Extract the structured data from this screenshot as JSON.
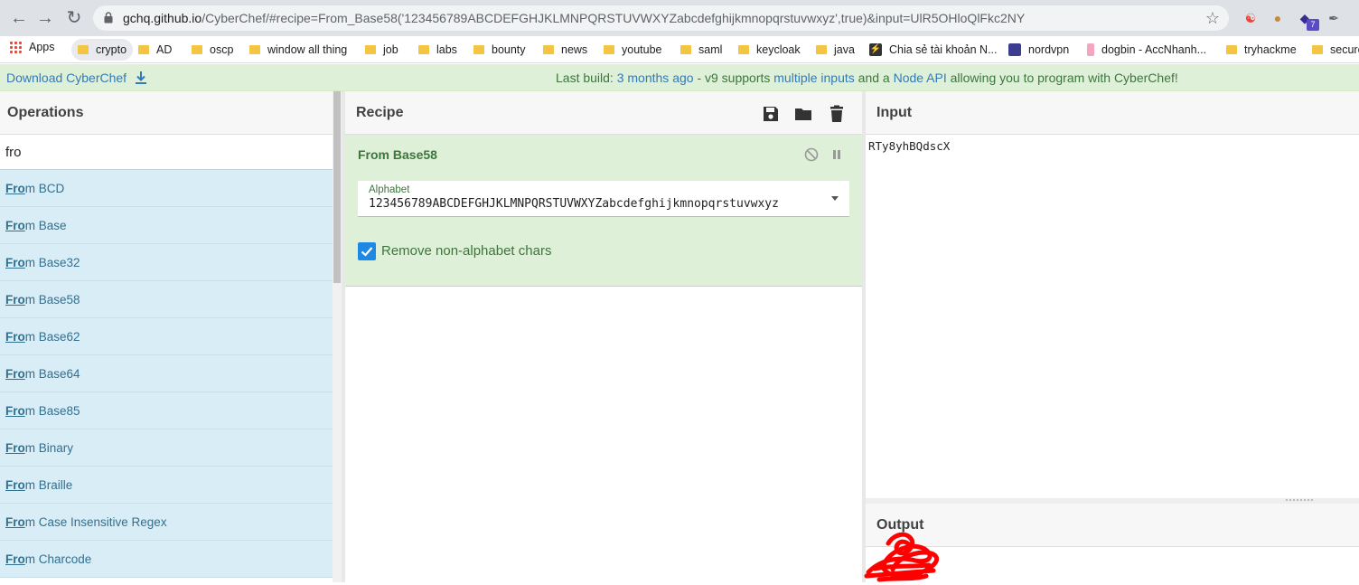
{
  "browser": {
    "url_host": "gchq.github.io",
    "url_path": "/CyberChef/#recipe=From_Base58('123456789ABCDEFGHJKLMNPQRSTUVWXYZabcdefghijkmnopqrstuvwxyz',true)&input=UlR5OHloQlFkc2NY",
    "bookmarks": [
      {
        "label": "Apps",
        "type": "apps"
      },
      {
        "label": "crypto",
        "type": "folder"
      },
      {
        "label": "AD",
        "type": "folder"
      },
      {
        "label": "oscp",
        "type": "folder"
      },
      {
        "label": "window all thing",
        "type": "folder"
      },
      {
        "label": "job",
        "type": "folder"
      },
      {
        "label": "labs",
        "type": "folder"
      },
      {
        "label": "bounty",
        "type": "folder"
      },
      {
        "label": "news",
        "type": "folder"
      },
      {
        "label": "youtube",
        "type": "folder"
      },
      {
        "label": "saml",
        "type": "folder"
      },
      {
        "label": "keycloak",
        "type": "folder"
      },
      {
        "label": "java",
        "type": "folder"
      },
      {
        "label": "Chia sẻ tài khoản N...",
        "type": "site"
      },
      {
        "label": "nordvpn",
        "type": "site"
      },
      {
        "label": "dogbin - AccNhanh...",
        "type": "site"
      },
      {
        "label": "tryhackme",
        "type": "folder"
      },
      {
        "label": "secure",
        "type": "folder"
      }
    ],
    "extension_badge": "7"
  },
  "banner": {
    "download_label": "Download CyberChef",
    "build_prefix": "Last build: ",
    "build_age": "3 months ago",
    "build_mid1": " - v9 supports ",
    "build_link1": "multiple inputs",
    "build_mid2": " and a ",
    "build_link2": "Node API",
    "build_suffix": " allowing you to program with CyberChef!"
  },
  "operations": {
    "title": "Operations",
    "search_value": "fro",
    "items": [
      {
        "hl": "Fro",
        "rest": "m BCD"
      },
      {
        "hl": "Fro",
        "rest": "m Base"
      },
      {
        "hl": "Fro",
        "rest": "m Base32"
      },
      {
        "hl": "Fro",
        "rest": "m Base58"
      },
      {
        "hl": "Fro",
        "rest": "m Base62"
      },
      {
        "hl": "Fro",
        "rest": "m Base64"
      },
      {
        "hl": "Fro",
        "rest": "m Base85"
      },
      {
        "hl": "Fro",
        "rest": "m Binary"
      },
      {
        "hl": "Fro",
        "rest": "m Braille"
      },
      {
        "hl": "Fro",
        "rest": "m Case Insensitive Regex"
      },
      {
        "hl": "Fro",
        "rest": "m Charcode"
      }
    ]
  },
  "recipe": {
    "title": "Recipe",
    "operation_name": "From Base58",
    "alphabet_label": "Alphabet",
    "alphabet_value": "123456789ABCDEFGHJKLMNPQRSTUVWXYZabcdefghijkmnopqrstuvwxyz",
    "remove_label": "Remove non-alphabet chars",
    "remove_checked": true
  },
  "input": {
    "title": "Input",
    "value": "RTy8yhBQdscX"
  },
  "output": {
    "title": "Output"
  },
  "colors": {
    "banner_bg": "#dff0d8",
    "op_item_bg": "#d9edf7",
    "recipe_bg": "#dff0d8",
    "checkbox": "#1e88e5",
    "redaction": "#ff0000"
  }
}
